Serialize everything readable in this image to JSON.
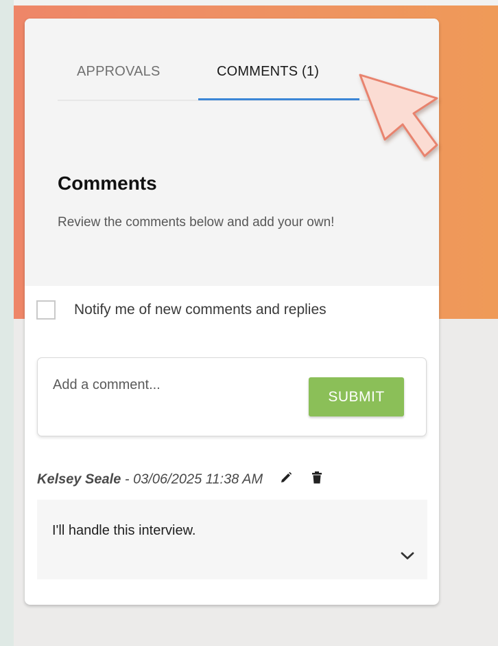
{
  "tabs": [
    {
      "label": "APPROVALS",
      "active": false
    },
    {
      "label": "COMMENTS (1)",
      "active": true
    }
  ],
  "section": {
    "title": "Comments",
    "description": "Review the comments below and add your own!"
  },
  "notify": {
    "label": "Notify me of new comments and replies",
    "checked": false
  },
  "composer": {
    "placeholder": "Add a comment...",
    "submit_label": "SUBMIT"
  },
  "comments": [
    {
      "author": "Kelsey Seale",
      "separator": " - ",
      "timestamp": "03/06/2025 11:38 AM",
      "text": "I'll handle this interview."
    }
  ],
  "colors": {
    "accent_blue": "#3b86d6",
    "submit_green": "#8bbf58",
    "banner_orange": "#ee8a66"
  },
  "icons": {
    "edit": "pencil-icon",
    "delete": "trash-icon",
    "expand": "chevron-down-icon",
    "pointer": "cursor-arrow-icon"
  }
}
